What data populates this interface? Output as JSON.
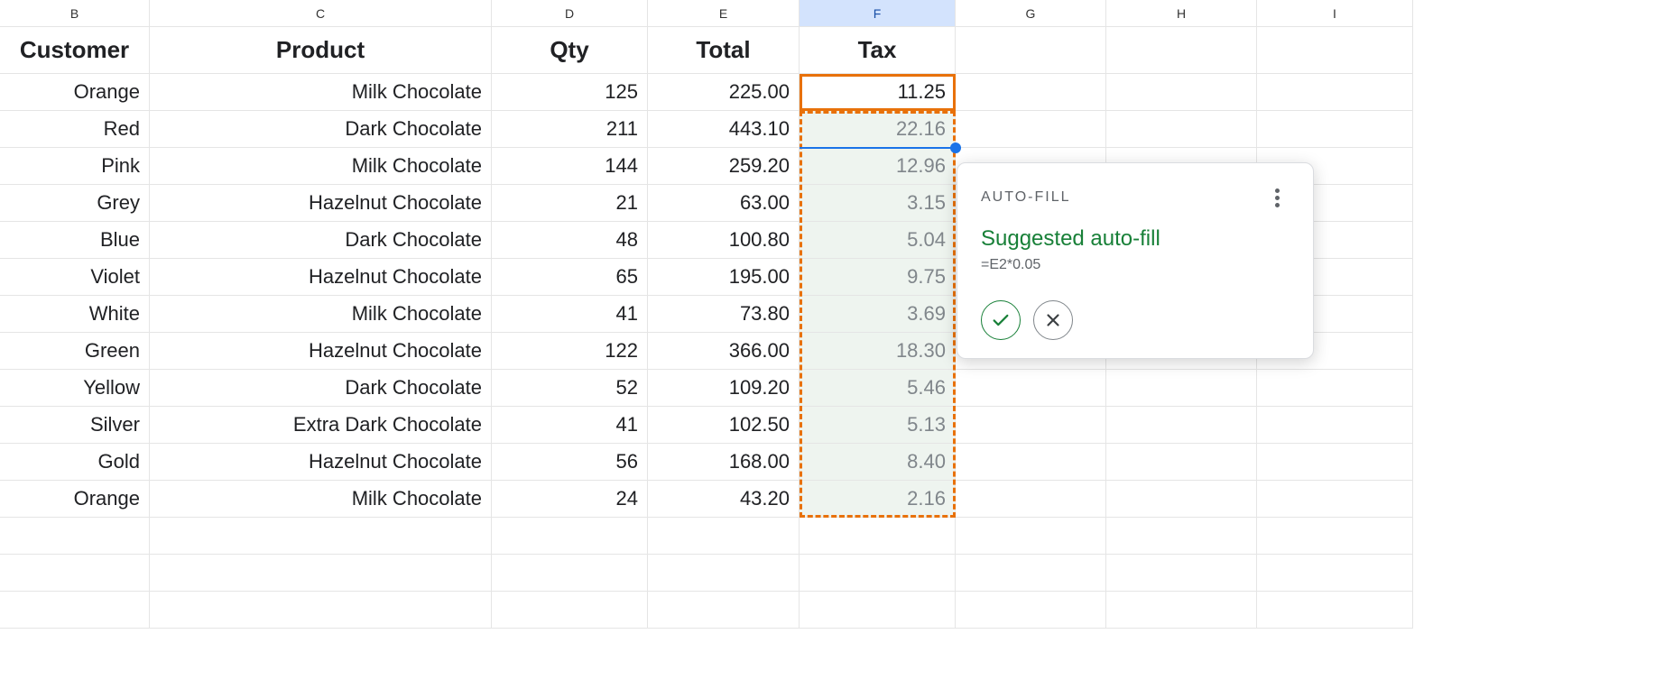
{
  "columns": [
    "B",
    "C",
    "D",
    "E",
    "F",
    "G",
    "H",
    "I"
  ],
  "selectedColumn": "F",
  "headers": {
    "customer": "Customer",
    "product": "Product",
    "qty": "Qty",
    "total": "Total",
    "tax": "Tax"
  },
  "rows": [
    {
      "customer": "Orange",
      "product": "Milk Chocolate",
      "qty": "125",
      "total": "225.00",
      "tax": "11.25"
    },
    {
      "customer": "Red",
      "product": "Dark Chocolate",
      "qty": "211",
      "total": "443.10",
      "tax": "22.16"
    },
    {
      "customer": "Pink",
      "product": "Milk Chocolate",
      "qty": "144",
      "total": "259.20",
      "tax": "12.96"
    },
    {
      "customer": "Grey",
      "product": "Hazelnut Chocolate",
      "qty": "21",
      "total": "63.00",
      "tax": "3.15"
    },
    {
      "customer": "Blue",
      "product": "Dark Chocolate",
      "qty": "48",
      "total": "100.80",
      "tax": "5.04"
    },
    {
      "customer": "Violet",
      "product": "Hazelnut Chocolate",
      "qty": "65",
      "total": "195.00",
      "tax": "9.75"
    },
    {
      "customer": "White",
      "product": "Milk Chocolate",
      "qty": "41",
      "total": "73.80",
      "tax": "3.69"
    },
    {
      "customer": "Green",
      "product": "Hazelnut Chocolate",
      "qty": "122",
      "total": "366.00",
      "tax": "18.30"
    },
    {
      "customer": "Yellow",
      "product": "Dark Chocolate",
      "qty": "52",
      "total": "109.20",
      "tax": "5.46"
    },
    {
      "customer": "Silver",
      "product": "Extra Dark Chocolate",
      "qty": "41",
      "total": "102.50",
      "tax": "5.13"
    },
    {
      "customer": "Gold",
      "product": "Hazelnut Chocolate",
      "qty": "56",
      "total": "168.00",
      "tax": "8.40"
    },
    {
      "customer": "Orange",
      "product": "Milk Chocolate",
      "qty": "24",
      "total": "43.20",
      "tax": "2.16"
    }
  ],
  "popup": {
    "label": "AUTO-FILL",
    "title": "Suggested auto-fill",
    "formula": "=E2*0.05"
  },
  "colors": {
    "selectionOrange": "#e8710a",
    "accentGreen": "#188038",
    "fillHandleBlue": "#1a73e8"
  }
}
